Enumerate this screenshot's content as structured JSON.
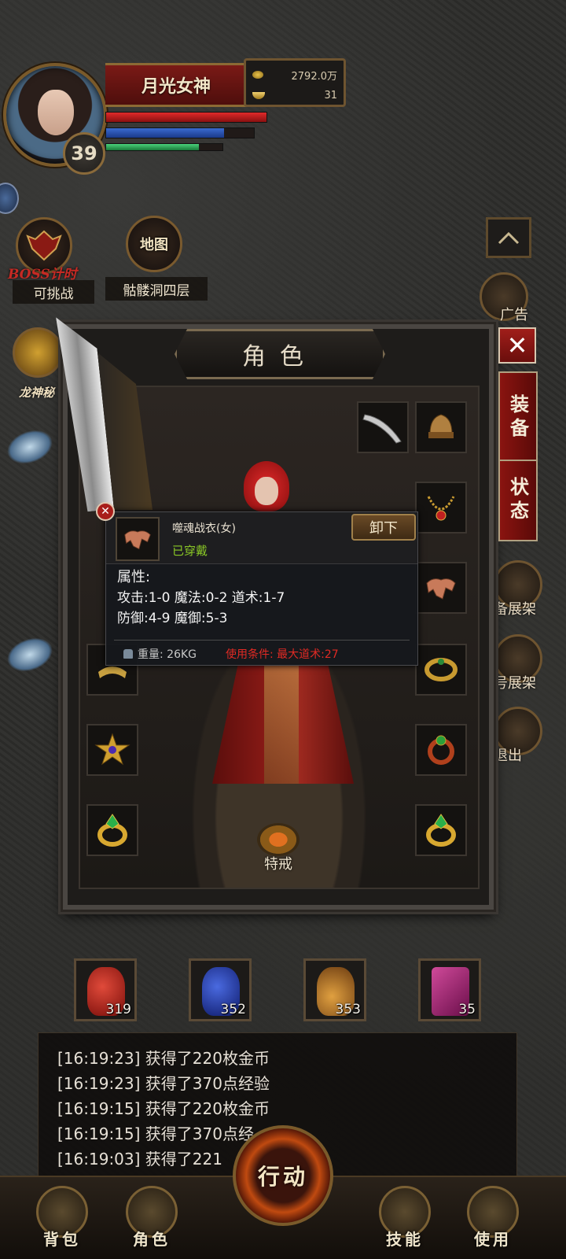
{
  "player": {
    "name": "月光女神",
    "level": "39",
    "gold": "2792.0万",
    "ingots": "31",
    "hp_fraction": 1.0,
    "mp_fraction": 0.8,
    "exp_fraction": 0.8
  },
  "left_menu": {
    "boss_timer": {
      "label": "BOSS计时",
      "status": "可挑战"
    },
    "map": {
      "label": "地图",
      "location": "骷髅洞四层"
    },
    "dragon": {
      "label": "龙神秘"
    }
  },
  "panel": {
    "title": "角色",
    "tabs": [
      "装备",
      "状态"
    ],
    "special_ring_label": "特戒"
  },
  "tooltip": {
    "item_name": "噬魂战衣(女)",
    "state": "已穿戴",
    "unequip_label": "卸下",
    "section": "属性:",
    "stats_line1": "攻击:1-0  魔法:0-2  道术:1-7",
    "stats_line2": "防御:4-9  魔御:5-3",
    "weight": "重量: 26KG",
    "requirement": "使用条件: 最大道术:27"
  },
  "right_menu": {
    "item1": "广告",
    "item2": "备展架",
    "item3": "号展架",
    "item4": "退出"
  },
  "potions": [
    {
      "name": "red-potion",
      "count": "319",
      "color": "#b0201a"
    },
    {
      "name": "blue-potion",
      "count": "352",
      "color": "#1e2e9a"
    },
    {
      "name": "sun-potion",
      "count": "353",
      "color": "#c0802a"
    },
    {
      "name": "scroll-pack",
      "count": "35",
      "color": "#a0206a"
    }
  ],
  "log": [
    "[16:19:23] 获得了220枚金币",
    "[16:19:23] 获得了370点经验",
    "[16:19:15] 获得了220枚金币",
    "[16:19:15] 获得了370点经",
    "[16:19:03] 获得了221"
  ],
  "nav": {
    "bag": "背包",
    "role": "角色",
    "action": "行动",
    "skills": "技能",
    "use": "使用"
  }
}
